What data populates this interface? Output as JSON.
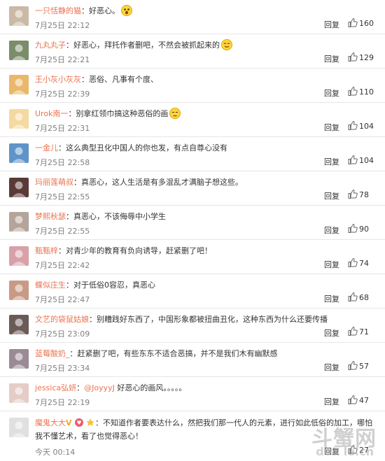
{
  "comments": [
    {
      "user": "一只恬静的猫",
      "text": "好恶心。",
      "time": "7月25日 22:12",
      "reply": "回复",
      "likes": "160",
      "avatar_color": "#c9b9a5",
      "emoji": "shock"
    },
    {
      "user": "九丸丸子",
      "text": "好恶心，拜托作者删吧，不然会被抓起来的",
      "time": "7月25日 22:21",
      "reply": "回复",
      "likes": "129",
      "avatar_color": "#7a8c6a",
      "emoji": "smile"
    },
    {
      "user": "王小灰小灰灰",
      "text": "恶俗、凡事有个度、",
      "time": "7月25日 22:39",
      "reply": "回复",
      "likes": "110",
      "avatar_color": "#e9b86a",
      "emoji": ""
    },
    {
      "user": "Urok南一",
      "text": "别拿红领巾搞这种恶俗的画",
      "time": "7月25日 22:31",
      "reply": "回复",
      "likes": "104",
      "avatar_color": "#f4d9a0",
      "emoji": "annoyed"
    },
    {
      "user": "一金儿",
      "text": "这么典型丑化中国人的你也发，有点自尊心没有",
      "time": "7月25日 22:58",
      "reply": "回复",
      "likes": "104",
      "avatar_color": "#5f93c9",
      "emoji": ""
    },
    {
      "user": "玛丽莲萌叔",
      "text": "真恶心，这人生活是有多混乱才满脑子想这些。",
      "time": "7月25日 22:55",
      "reply": "回复",
      "likes": "78",
      "avatar_color": "#5a3a36",
      "emoji": ""
    },
    {
      "user": "梦熙秋瑟",
      "text": "真恶心，不该侮辱中小学生",
      "time": "7月25日 22:55",
      "reply": "回复",
      "likes": "90",
      "avatar_color": "#b4a49a",
      "emoji": ""
    },
    {
      "user": "甄甄梓",
      "text": "对青少年的教育有负向诱导，赶紧删了吧！",
      "time": "7月25日 22:42",
      "reply": "回复",
      "likes": "74",
      "avatar_color": "#d8a0a8",
      "emoji": ""
    },
    {
      "user": "蝶似庄生",
      "text": "对于低俗0容忍，真恶心",
      "time": "7月25日 22:47",
      "reply": "回复",
      "likes": "68",
      "avatar_color": "#c89a86",
      "emoji": ""
    },
    {
      "user": "文艺的袋鼠姑娘",
      "text": "别糟践好东西了，中国形象都被扭曲丑化，这种东西为什么还要传播",
      "time": "7月25日 23:09",
      "reply": "回复",
      "likes": "71",
      "avatar_color": "#6b5b57",
      "emoji": ""
    },
    {
      "user": "蓝莓酸奶_",
      "text": "赶紧删了吧，有些东东不适合恶搞，并不是我们木有幽默感",
      "time": "7月25日 23:34",
      "reply": "回复",
      "likes": "57",
      "avatar_color": "#9a8a94",
      "emoji": ""
    },
    {
      "user": "jessica弘妍",
      "mention": "@JoyyyJ",
      "text": " 好恶心的画风。。。。。",
      "time": "7月25日 22:19",
      "reply": "回复",
      "likes": "47",
      "avatar_color": "#e5ccc6",
      "emoji": ""
    },
    {
      "user": "魔鬼大大",
      "text": "不知道作者要表达什么，然把我们那一代人的元素，进行如此低俗的加工，哪怕我不懂艺术，看了也觉得恶心！",
      "time": "今天 00:14",
      "reply": "回复",
      "likes": "27",
      "avatar_color": "#e0e0e0",
      "emoji": "",
      "badge": "V"
    }
  ],
  "watermark": {
    "big": "斗蟹网",
    "small": "dou le.cn"
  },
  "colors": {
    "username": "#eb7350",
    "time": "#808080",
    "divider": "#e6e6e6"
  }
}
